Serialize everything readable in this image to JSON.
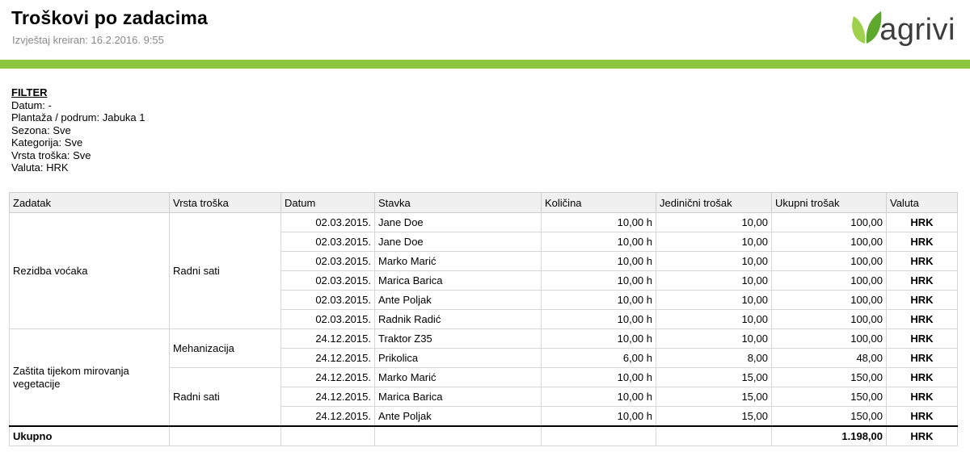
{
  "report": {
    "title": "Troškovi po zadacima",
    "created": "Izvještaj kreiran: 16.2.2016. 9:55",
    "logo_text": "agrivi"
  },
  "filter": {
    "title": "FILTER",
    "rows": [
      {
        "label": "Datum:",
        "value": " -"
      },
      {
        "label": "Plantaža / podrum:",
        "value": " Jabuka 1"
      },
      {
        "label": "Sezona:",
        "value": " Sve"
      },
      {
        "label": "Kategorija:",
        "value": " Sve"
      },
      {
        "label": "Vrsta troška:",
        "value": " Sve"
      },
      {
        "label": "Valuta:",
        "value": " HRK"
      }
    ]
  },
  "table": {
    "headers": [
      "Zadatak",
      "Vrsta troška",
      "Datum",
      "Stavka",
      "Količina",
      "Jedinični trošak",
      "Ukupni trošak",
      "Valuta"
    ],
    "groups": [
      {
        "task": "Rezidba voćaka",
        "types": [
          {
            "type": "Radni sati",
            "rows": [
              {
                "date": "02.03.2015.",
                "item": "Jane Doe",
                "qty": "10,00 h",
                "unit": "10,00",
                "total": "100,00",
                "currency": "HRK"
              },
              {
                "date": "02.03.2015.",
                "item": "Jane Doe",
                "qty": "10,00 h",
                "unit": "10,00",
                "total": "100,00",
                "currency": "HRK"
              },
              {
                "date": "02.03.2015.",
                "item": "Marko Marić",
                "qty": "10,00 h",
                "unit": "10,00",
                "total": "100,00",
                "currency": "HRK"
              },
              {
                "date": "02.03.2015.",
                "item": "Marica Barica",
                "qty": "10,00 h",
                "unit": "10,00",
                "total": "100,00",
                "currency": "HRK"
              },
              {
                "date": "02.03.2015.",
                "item": "Ante Poljak",
                "qty": "10,00 h",
                "unit": "10,00",
                "total": "100,00",
                "currency": "HRK"
              },
              {
                "date": "02.03.2015.",
                "item": "Radnik Radić",
                "qty": "10,00 h",
                "unit": "10,00",
                "total": "100,00",
                "currency": "HRK"
              }
            ]
          }
        ]
      },
      {
        "task": "Zaštita tijekom mirovanja vegetacije",
        "types": [
          {
            "type": "Mehanizacija",
            "rows": [
              {
                "date": "24.12.2015.",
                "item": "Traktor Z35",
                "qty": "10,00 h",
                "unit": "10,00",
                "total": "100,00",
                "currency": "HRK"
              },
              {
                "date": "24.12.2015.",
                "item": "Prikolica",
                "qty": "6,00 h",
                "unit": "8,00",
                "total": "48,00",
                "currency": "HRK"
              }
            ]
          },
          {
            "type": "Radni sati",
            "rows": [
              {
                "date": "24.12.2015.",
                "item": "Marko Marić",
                "qty": "10,00 h",
                "unit": "15,00",
                "total": "150,00",
                "currency": "HRK"
              },
              {
                "date": "24.12.2015.",
                "item": "Marica Barica",
                "qty": "10,00 h",
                "unit": "15,00",
                "total": "150,00",
                "currency": "HRK"
              },
              {
                "date": "24.12.2015.",
                "item": "Ante Poljak",
                "qty": "10,00 h",
                "unit": "15,00",
                "total": "150,00",
                "currency": "HRK"
              }
            ]
          }
        ]
      }
    ],
    "total": {
      "label": "Ukupno",
      "amount": "1.198,00",
      "currency": "HRK"
    }
  },
  "colors": {
    "accent_green": "#8dc63f",
    "logo_leaf_dark": "#5fa82e",
    "logo_leaf_light": "#9fd14f"
  }
}
